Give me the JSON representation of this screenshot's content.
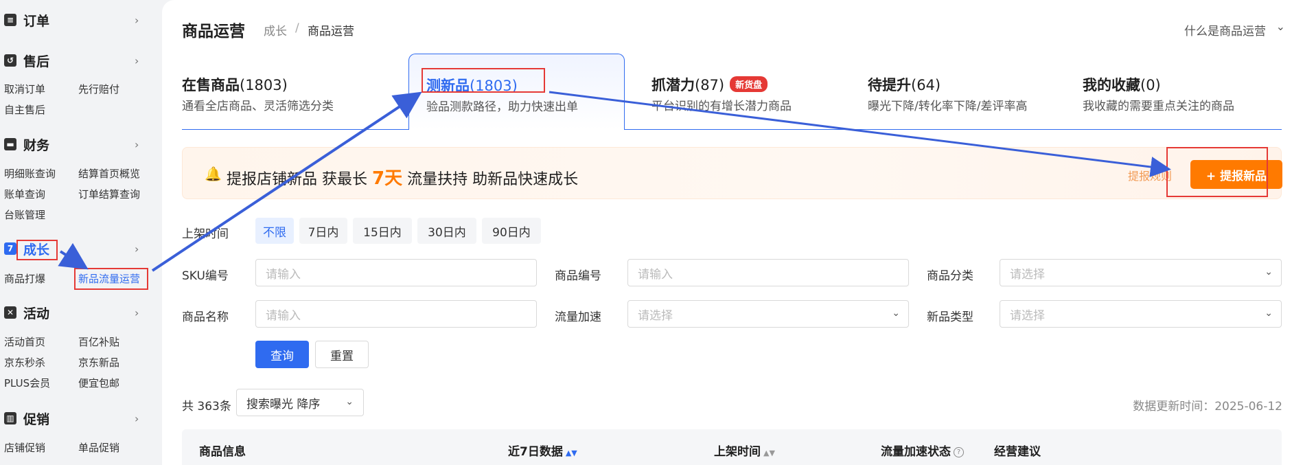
{
  "sidebar": {
    "sections": [
      {
        "title": "订单",
        "icon": "list-icon",
        "items": []
      },
      {
        "title": "售后",
        "icon": "return-icon",
        "items": [
          "取消订单",
          "先行赔付",
          "自主售后"
        ]
      },
      {
        "title": "财务",
        "icon": "wallet-icon",
        "items": [
          "明细账查询",
          "结算首页概览",
          "账单查询",
          "订单结算查询",
          "台账管理"
        ]
      },
      {
        "title": "成长",
        "icon": "growth-icon",
        "items": [
          "商品打爆",
          "新品流量运营"
        ]
      },
      {
        "title": "活动",
        "icon": "activity-icon",
        "items": [
          "活动首页",
          "百亿补贴",
          "京东秒杀",
          "京东新品",
          "PLUS会员",
          "便宜包邮"
        ]
      },
      {
        "title": "促销",
        "icon": "promo-icon",
        "items": [
          "店铺促销",
          "单品促销"
        ]
      }
    ],
    "chevron": "›",
    "active_section": "成长",
    "active_item": "新品流量运营"
  },
  "header": {
    "title": "商品运营",
    "breadcrumb": [
      "成长",
      "商品运营"
    ],
    "breadcrumb_sep": "/",
    "help_link": "什么是商品运营"
  },
  "tabs": [
    {
      "title": "在售商品",
      "count": "(1803)",
      "desc": "通看全店商品、灵活筛选分类"
    },
    {
      "title": "测新品",
      "count": "(1803)",
      "desc": "验品测款路径，助力快速出单",
      "active": true
    },
    {
      "title": "抓潜力",
      "count": "(87)",
      "badge": "新货盘",
      "desc": "平台识别的有增长潜力商品"
    },
    {
      "title": "待提升",
      "count": "(64)",
      "desc": "曝光下降/转化率下降/差评率高"
    },
    {
      "title": "我的收藏",
      "count": "(0)",
      "desc": "我收藏的需要重点关注的商品"
    }
  ],
  "banner": {
    "text_before": "提报店铺新品 获最长",
    "highlight": "7天",
    "text_after": "流量扶持 助新品快速成长",
    "rules_link": "提报规则",
    "button": "+ 提报新品"
  },
  "filters": {
    "listing_time_label": "上架时间",
    "listing_time_options": [
      "不限",
      "7日内",
      "15日内",
      "30日内",
      "90日内"
    ],
    "sku_label": "SKU编号",
    "sku_placeholder": "请输入",
    "product_no_label": "商品编号",
    "product_no_placeholder": "请输入",
    "category_label": "商品分类",
    "category_placeholder": "请选择",
    "name_label": "商品名称",
    "name_placeholder": "请输入",
    "traffic_label": "流量加速",
    "traffic_placeholder": "请选择",
    "newtype_label": "新品类型",
    "newtype_placeholder": "请选择",
    "query_button": "查询",
    "reset_button": "重置"
  },
  "results": {
    "total": "共 363条",
    "sort_value": "搜索曝光 降序",
    "update_time": "数据更新时间：2025-06-12"
  },
  "table": {
    "columns": [
      "商品信息",
      "近7日数据",
      "上架时间",
      "流量加速状态",
      "经营建议"
    ]
  },
  "colors": {
    "accent": "#2f6bf0",
    "orange": "#ff7a00",
    "annotation_red": "#e53935"
  }
}
